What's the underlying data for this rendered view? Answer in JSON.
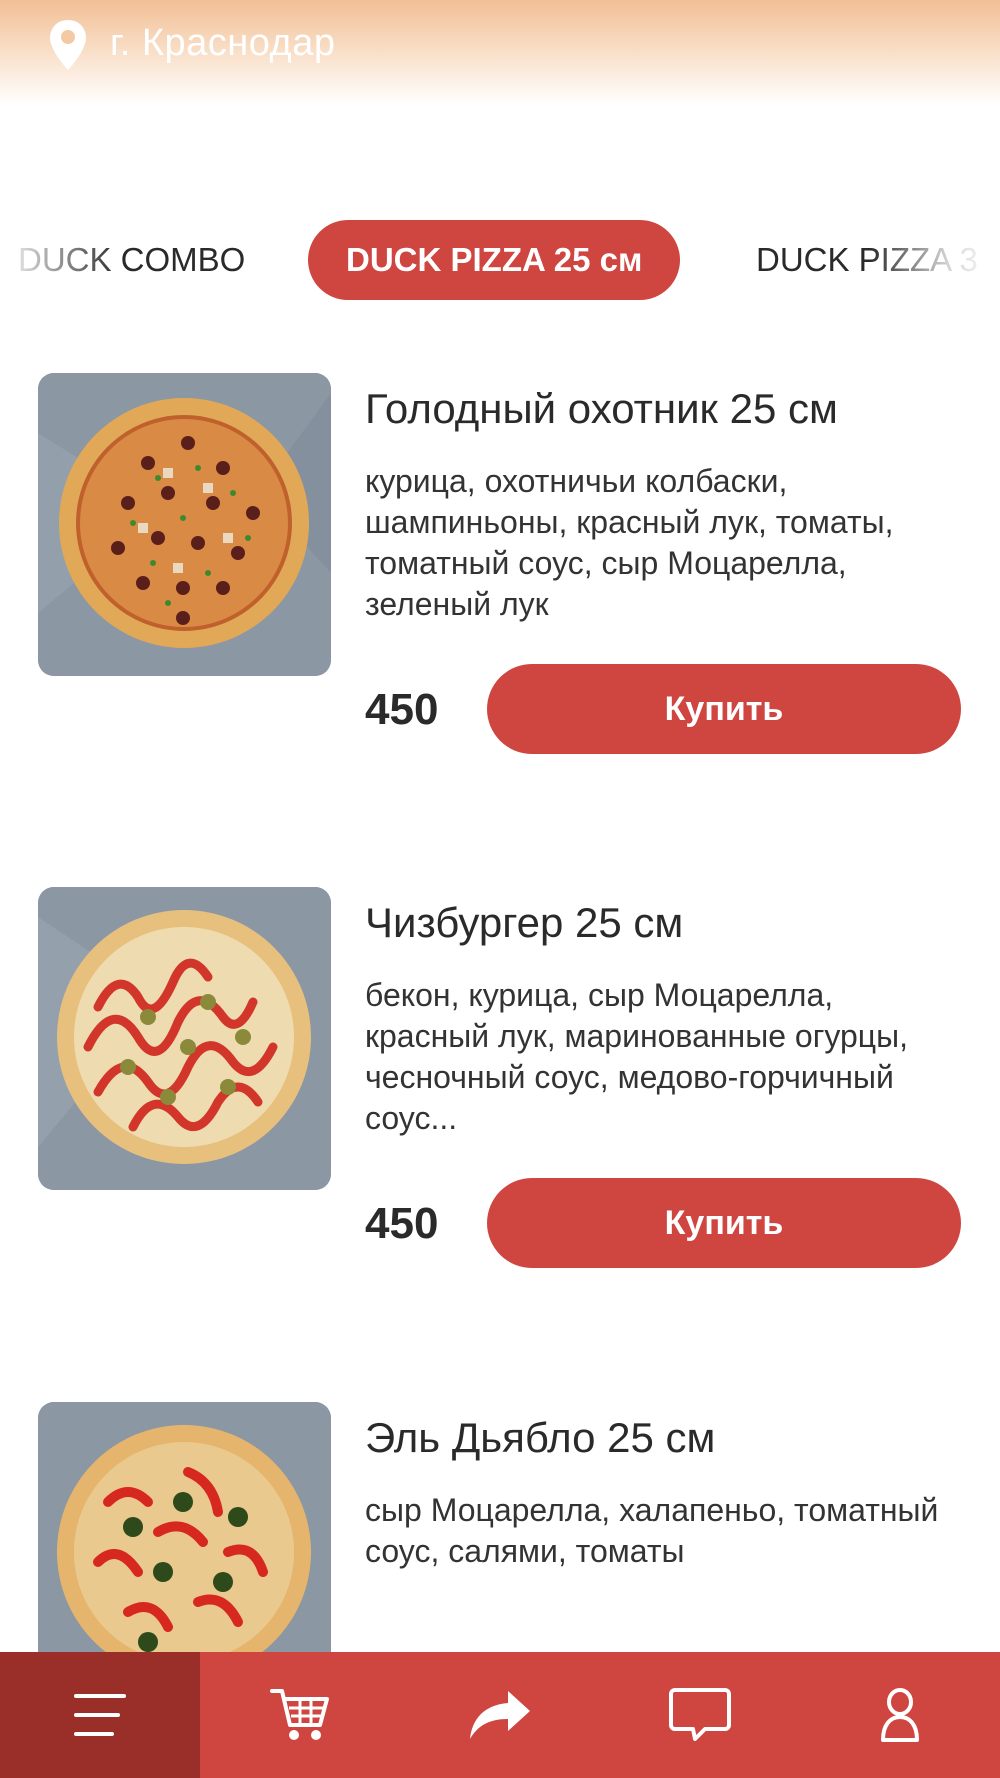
{
  "header": {
    "city": "г. Краснодар",
    "icon": "location-pin-icon"
  },
  "tabs": [
    {
      "label": "DUCK COMBO",
      "active": false
    },
    {
      "label": "DUCK PIZZA 25 см",
      "active": true
    },
    {
      "label": "DUCK PIZZA 3",
      "active": false
    }
  ],
  "products": [
    {
      "name": "Голодный охотник 25 см",
      "description": "курица, охотничьи колбаски, шампиньоны, красный лук, томаты, томатный соус, сыр Моцарелла, зеленый лук",
      "price": "450",
      "buy_label": "Купить"
    },
    {
      "name": "Чизбургер 25 см",
      "description": "бекон, курица, сыр Моцарелла, красный лук, маринованные огурцы, чесночный соус, медово-горчичный соус...",
      "price": "450",
      "buy_label": "Купить"
    },
    {
      "name": "Эль Дьябло 25 см",
      "description": "сыр Моцарелла, халапеньо, томатный соус, салями, томаты",
      "price": "",
      "buy_label": ""
    }
  ],
  "bottom_nav": {
    "items": [
      {
        "icon": "menu-icon",
        "active": true
      },
      {
        "icon": "cart-icon",
        "active": false
      },
      {
        "icon": "share-icon",
        "active": false
      },
      {
        "icon": "chat-icon",
        "active": false
      },
      {
        "icon": "profile-icon",
        "active": false
      }
    ]
  },
  "colors": {
    "accent": "#cf4540",
    "accent_dark": "#9a2f2a",
    "header_top": "#f2bf96",
    "text": "#2a2a2a"
  }
}
